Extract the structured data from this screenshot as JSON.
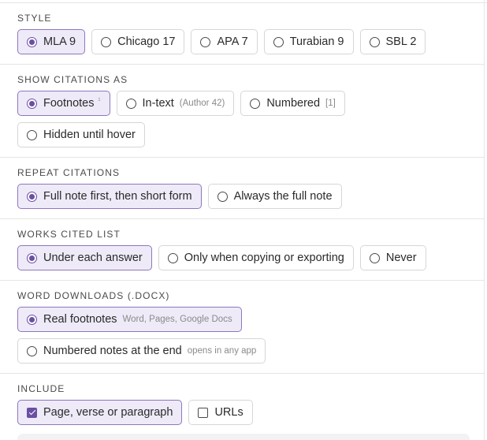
{
  "sections": {
    "style": {
      "label": "STYLE",
      "options": [
        "MLA 9",
        "Chicago 17",
        "APA 7",
        "Turabian 9",
        "SBL 2"
      ],
      "selected": "MLA 9"
    },
    "show_citations": {
      "label": "SHOW CITATIONS AS",
      "options": [
        {
          "label": "Footnotes",
          "sup": "¹"
        },
        {
          "label": "In-text",
          "hint": "(Author 42)"
        },
        {
          "label": "Numbered",
          "hint": "[1]"
        },
        {
          "label": "Hidden until hover"
        }
      ],
      "selected": "Footnotes"
    },
    "repeat_citations": {
      "label": "REPEAT CITATIONS",
      "options": [
        "Full note first, then short form",
        "Always the full note"
      ],
      "selected": "Full note first, then short form"
    },
    "works_cited": {
      "label": "WORKS CITED LIST",
      "options": [
        "Under each answer",
        "Only when copying or exporting",
        "Never"
      ],
      "selected": "Under each answer"
    },
    "word_downloads": {
      "label": "WORD DOWNLOADS (.DOCX)",
      "options": [
        {
          "label": "Real footnotes",
          "hint": "Word, Pages, Google Docs"
        },
        {
          "label": "Numbered notes at the end",
          "hint": "opens in any app"
        }
      ],
      "selected": "Real footnotes"
    },
    "include": {
      "label": "INCLUDE",
      "options": [
        {
          "label": "Page, verse or paragraph",
          "checked": true
        },
        {
          "label": "URLs",
          "checked": false
        }
      ]
    }
  },
  "colors": {
    "accent": "#6a4fa3",
    "selected_bg": "#efeaf8",
    "selected_border": "#8e77bd"
  }
}
